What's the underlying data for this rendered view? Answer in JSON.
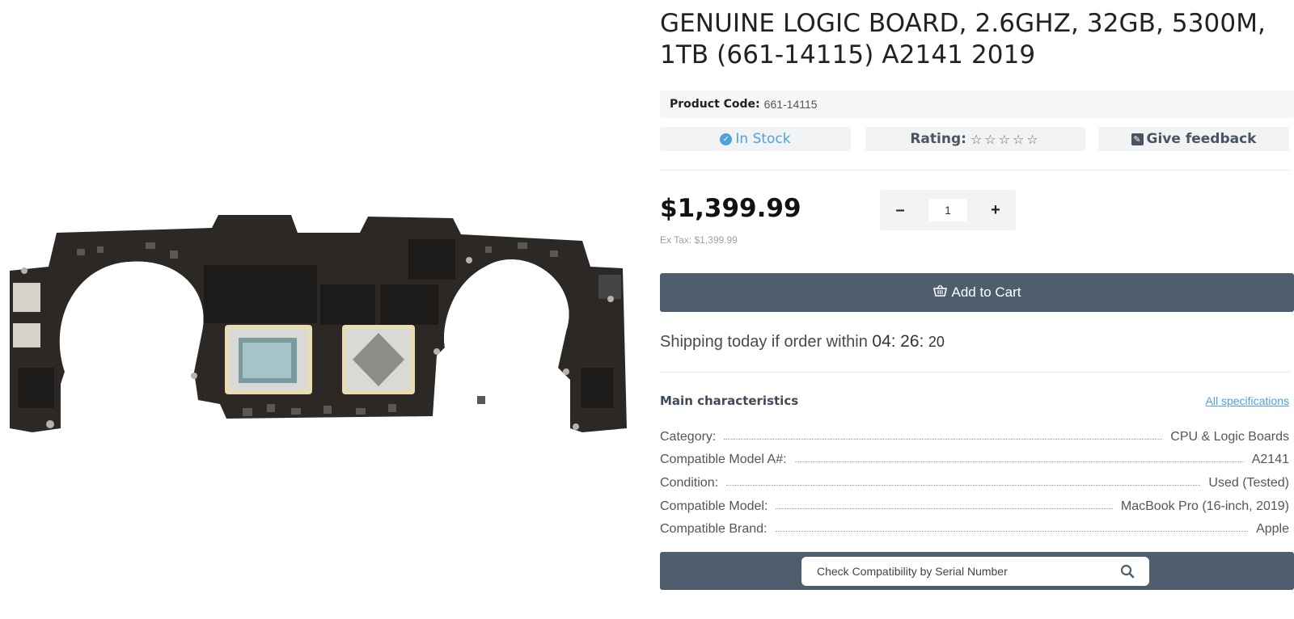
{
  "product": {
    "title": "GENUINE LOGIC BOARD, 2.6GHZ, 32GB, 5300M, 1TB (661-14115) A2141 2019",
    "code_label": "Product Code:",
    "code_value": "661-14115",
    "stock_text": "In Stock",
    "rating_label": "Rating:",
    "rating_value": 0,
    "rating_max": 5,
    "rating_stars": "☆☆☆☆☆",
    "feedback_label": "Give feedback",
    "price": "$1,399.99",
    "ex_tax": "Ex Tax: $1,399.99",
    "quantity": "1",
    "minus_label": "–",
    "plus_label": "+",
    "add_to_cart": "Add to Cart"
  },
  "shipping": {
    "prefix": "Shipping today if order within",
    "hours": "04",
    "minutes": "26",
    "seconds": "20"
  },
  "characteristics": {
    "title": "Main characteristics",
    "link": "All specifications",
    "rows": [
      {
        "key": "Category:",
        "value": "CPU & Logic Boards"
      },
      {
        "key": "Compatible Model A#:",
        "value": "A2141"
      },
      {
        "key": "Condition:",
        "value": "Used (Tested)"
      },
      {
        "key": "Compatible Model:",
        "value": "MacBook Pro (16-inch, 2019)"
      },
      {
        "key": "Compatible Brand:",
        "value": "Apple"
      }
    ]
  },
  "serial": {
    "placeholder": "Check Compatibility by Serial Number"
  },
  "icons": {
    "stock": "check-circle-icon",
    "feedback": "edit-icon",
    "cart": "basket-icon",
    "search": "search-icon"
  },
  "colors": {
    "accent": "#4da3d9",
    "button": "#4f5e6d",
    "chip_bg": "#f1f3f5",
    "board": "#2b2826"
  }
}
